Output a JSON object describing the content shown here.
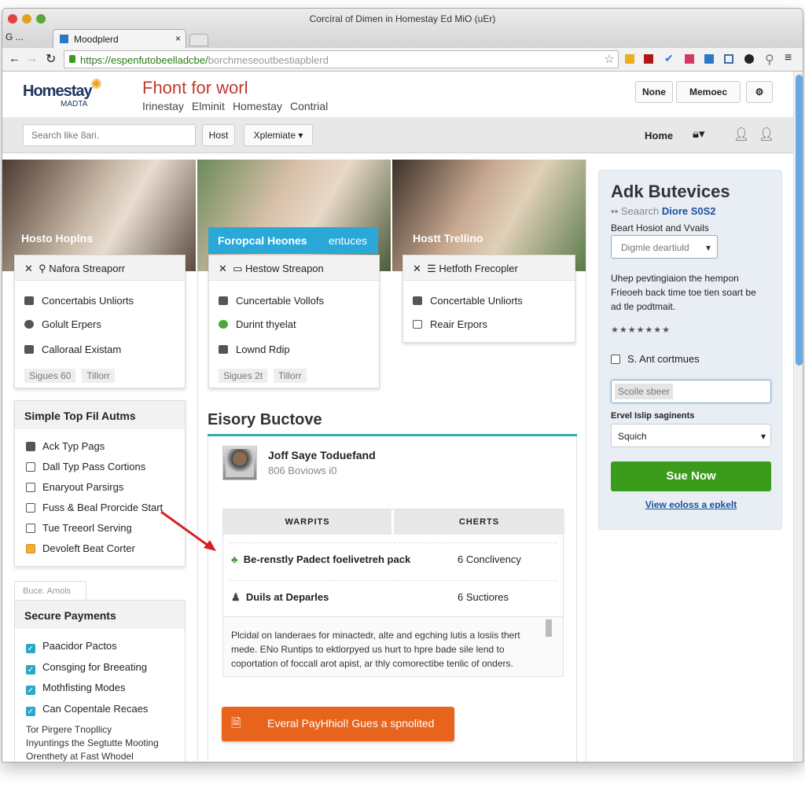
{
  "window": {
    "title": "Corcíral of Dimen in Homestay Ed MiO (uEr)",
    "tab_prev": "G ...",
    "tab_label": "Moodplerd",
    "url_host": "https://espenfutobeelladcbe/",
    "url_path": "borchmeseoutbestiapblerd"
  },
  "colors": {
    "accent_red": "#c0392b",
    "teal": "#2aa8c8",
    "green": "#3a9c1a",
    "orange": "#e8641c",
    "link": "#1a4f9c"
  },
  "header": {
    "logo": "Homestay",
    "logo_sub": "MADTA",
    "title": "Fhont for worl",
    "links": [
      "Irinestay",
      "Elminit",
      "Homestay",
      "Contrial"
    ],
    "buttons": [
      "None",
      "Memoec"
    ]
  },
  "nav": {
    "search_placeholder": "Search like 8ari.",
    "host": "Host",
    "dropdown": "Xplemiate",
    "home": "Home"
  },
  "cards": [
    {
      "photo_caption": "Hosto Hoplns",
      "head": "Nafora Streaporr",
      "items": [
        "Concertabis Unliorts",
        "Golult Erpers",
        "Calloraal Existam"
      ],
      "chips": [
        "Sigues 60",
        "Tillorr"
      ]
    },
    {
      "photo_caption": "Forорcal Heones",
      "photo_extra": "entuces",
      "head": "Hestow Streapon",
      "items": [
        "Cuncertable Vollofs",
        "Durint thyelat",
        "Lownd Rdip"
      ],
      "chips": [
        "Sigues 2t",
        "Tillorr"
      ]
    },
    {
      "photo_caption": "Hostt Trellino",
      "head": "Hetfoth Frecopler",
      "items": [
        "Concertable Unliorts",
        "Reair Erpors"
      ],
      "chips": []
    }
  ],
  "left_panel": {
    "title": "Simple Top Fil Autms",
    "items": [
      "Ack Typ Pags",
      "Dall Typ Pass Cortions",
      "Enaryout Parsirgs",
      "Fuss & Beal Prorcide Start",
      "Tue Treeorl Serving",
      "Devoleft Beat Corter"
    ]
  },
  "payments": {
    "tab": "Buce. Amols",
    "title": "Secure Payments",
    "items": [
      "Paacidor Pactos",
      "Consging for Breeating",
      "Mothfisting Modes",
      "Can Copentale Recaes"
    ],
    "note": [
      "Tor Pirgere Tnopllicy",
      "Inyuntings the Segtutte Mooting",
      "Orenthety at Fast Whodel"
    ]
  },
  "main": {
    "section_title": "Eisory Buctove",
    "profile_name": "Joff Saye Toduefand",
    "profile_sub": "806 Boviows i0",
    "table": {
      "headers": [
        "WARPITS",
        "CHERTS"
      ],
      "rows": [
        [
          "Be-renstly Padect foelivetreh pack",
          "6 Conclivency"
        ],
        [
          "Duils at Deparles",
          "6 Suctiores"
        ]
      ]
    },
    "text": "Plcidal on landeraes for minactedr, alte and egching lutis a losiis thert mede. ENo Runtips to ektlorpyed us hurt to hpre bade sile lend to coportation of foccall arot apist, ar thly comorectibe tenlic of onders.",
    "cta": "Everal PayHhiol! Gues a spnolited"
  },
  "sidebar": {
    "title": "Adk Butevices",
    "search_label": "Seaarch",
    "search_value": "Diore S0S2",
    "select_label": "Beart Hosiot and Vvails",
    "select_value": "Digmle deartiuld",
    "desc": "Uhep pevtingiaion the hempon Frieoeh back time toe tien soart be ad tle podtmait.",
    "rating": 7,
    "checkbox": "S. Ant cortmues",
    "input_value": "Scolle sbeer",
    "select2_label": "Ervel Islip saginents",
    "select2_value": "Squich",
    "button": "Sue Now",
    "link": "View eoloss a epkelt"
  }
}
